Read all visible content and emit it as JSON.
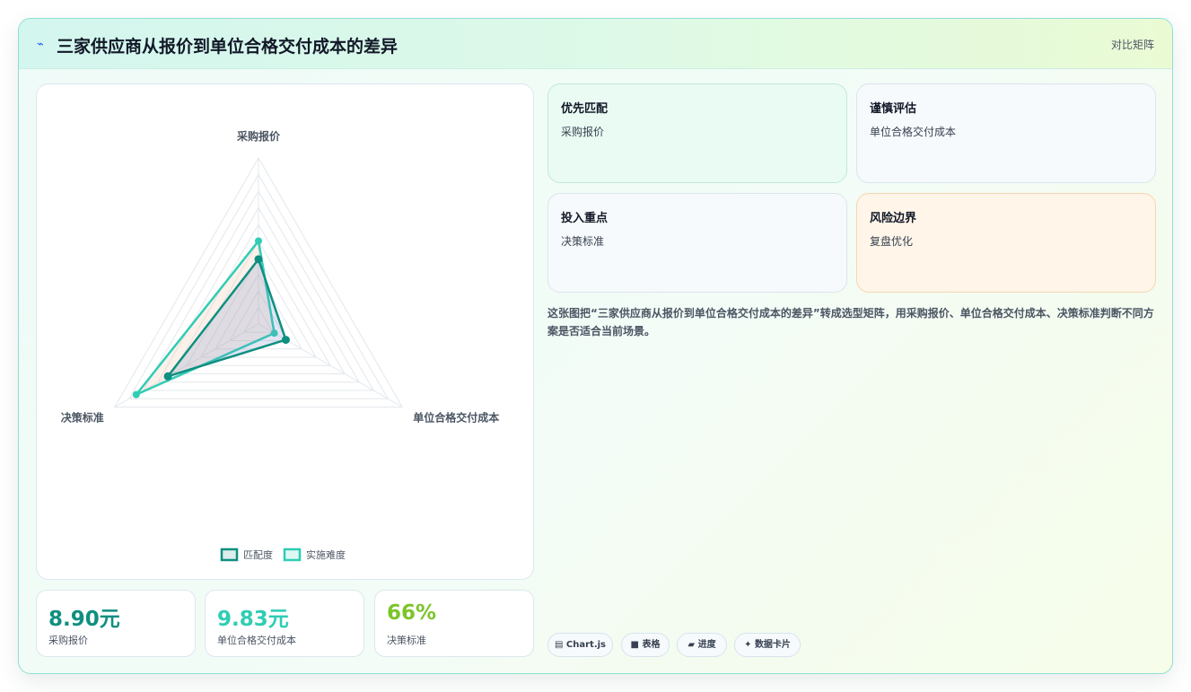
{
  "header": {
    "icon": "lightning-icon",
    "title": "三家供应商从报价到单位合格交付成本的差异",
    "tag": "对比矩阵"
  },
  "chart_data": {
    "type": "radar",
    "axes": [
      "采购报价",
      "单位合格交付成本",
      "决策标准"
    ],
    "rmax": 10,
    "grid_levels": 10,
    "series": [
      {
        "name": "匹配度",
        "values": [
          3.9,
          1.9,
          6.3
        ],
        "color": "#0f8f80"
      },
      {
        "name": "实施难度",
        "values": [
          5.0,
          1.1,
          8.5
        ],
        "color": "#2fcdb4"
      }
    ],
    "legend_position": "bottom"
  },
  "stats": [
    {
      "value": "8.90元",
      "label": "采购报价",
      "color": "#0f8f80"
    },
    {
      "value": "9.83元",
      "label": "单位合格交付成本",
      "color": "#2fcdb4"
    },
    {
      "value": "66%",
      "label": "决策标准",
      "color": "#7cc42a"
    }
  ],
  "tiles": [
    {
      "title": "优先匹配",
      "subtitle": "采购报价",
      "bg": "#eafbf3",
      "border": "#bfead7"
    },
    {
      "title": "谨慎评估",
      "subtitle": "单位合格交付成本",
      "bg": "#f7fafc",
      "border": "#dbe5ee"
    },
    {
      "title": "投入重点",
      "subtitle": "决策标准",
      "bg": "#f7fafc",
      "border": "#dbe5ee"
    },
    {
      "title": "风险边界",
      "subtitle": "复盘优化",
      "bg": "#fff5e8",
      "border": "#f5d6b2"
    }
  ],
  "description": "这张图把“三家供应商从报价到单位合格交付成本的差异”转成选型矩阵，用采购报价、单位合格交付成本、决策标准判断不同方案是否适合当前场景。",
  "chips": [
    {
      "icon": "chart-icon",
      "glyph": "▤",
      "label": "Chart.js"
    },
    {
      "icon": "table-icon",
      "glyph": "■",
      "label": "表格"
    },
    {
      "icon": "progress-icon",
      "glyph": "▰",
      "label": "进度"
    },
    {
      "icon": "sparkle-icon",
      "glyph": "✦",
      "label": "数据卡片"
    }
  ]
}
